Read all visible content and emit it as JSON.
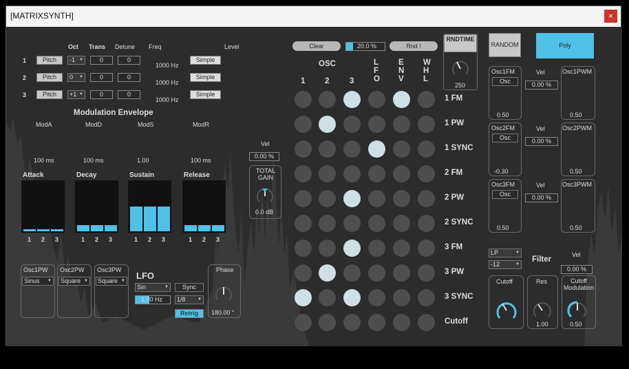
{
  "window": {
    "title": "[MATRIXSYNTH]",
    "close_glyph": "×"
  },
  "osc_section": {
    "headers": {
      "oct": "Oct",
      "trans": "Trans",
      "detune": "Detune",
      "freq": "Freq",
      "level": "Level"
    },
    "rows": [
      {
        "num": "1",
        "mode": "Pitch",
        "oct": "-1",
        "trans": "0",
        "detune": "0",
        "freq": "1000 Hz",
        "wave": "Simple"
      },
      {
        "num": "2",
        "mode": "Pitch",
        "oct": "0",
        "trans": "0",
        "detune": "0",
        "freq": "1000 Hz",
        "wave": "Simple"
      },
      {
        "num": "3",
        "mode": "Pitch",
        "oct": "+1",
        "trans": "0",
        "detune": "0",
        "freq": "1000 Hz",
        "wave": "Simple"
      }
    ]
  },
  "mod_env": {
    "title": "Modulation Envelope",
    "knobs": [
      {
        "label": "ModA",
        "value": "100 ms"
      },
      {
        "label": "ModD",
        "value": "100 ms"
      },
      {
        "label": "ModS",
        "value": "1.00"
      },
      {
        "label": "ModR",
        "value": "100 ms"
      }
    ],
    "vel_label": "Vel",
    "vel_value": "0.00 %",
    "total_gain_label": "TOTAL GAIN",
    "total_gain_value": "0.0 dB"
  },
  "adsr": {
    "groups": [
      {
        "label": "Attack",
        "levels": [
          0.04,
          0.04,
          0.04
        ]
      },
      {
        "label": "Decay",
        "levels": [
          0.12,
          0.12,
          0.12
        ]
      },
      {
        "label": "Sustain",
        "levels": [
          0.5,
          0.5,
          0.5
        ]
      },
      {
        "label": "Release",
        "levels": [
          0.12,
          0.12,
          0.12
        ]
      }
    ],
    "channel_labels": [
      "1",
      "2",
      "3"
    ]
  },
  "pwm": [
    {
      "label": "Osc1PW",
      "wave": "Sinus"
    },
    {
      "label": "Osc2PW",
      "wave": "Square"
    },
    {
      "label": "Osc3PW",
      "wave": "Square"
    }
  ],
  "lfo": {
    "title": "LFO",
    "wave": "Sin",
    "rate": "1.00 Hz",
    "sync_label": "Sync",
    "sync_value": "1/8",
    "retrig": "Retrig",
    "phase_label": "Phase",
    "phase_value": "180.00 °"
  },
  "matrix": {
    "clear": "Clear",
    "percent": "20.0 %",
    "rnd": "Rnd !",
    "osc_header": "OSC",
    "cols": [
      "1",
      "2",
      "3",
      "L F O",
      "E N V",
      "W H L"
    ],
    "rows": [
      "1 FM",
      "1 PW",
      "1 SYNC",
      "2 FM",
      "2 PW",
      "2 SYNC",
      "3 FM",
      "3 PW",
      "3 SYNC",
      "Cutoff"
    ],
    "active": [
      [
        1,
        1
      ],
      [
        2,
        0
      ],
      [
        4,
        0
      ],
      [
        3,
        2
      ],
      [
        2,
        4
      ],
      [
        2,
        6
      ],
      [
        1,
        7
      ],
      [
        0,
        8
      ],
      [
        2,
        8
      ]
    ]
  },
  "rndtime": {
    "label": "RNDTIME",
    "value": "250"
  },
  "right": {
    "random": "RANDOM",
    "poly": "Poly",
    "fm_rows": [
      {
        "fm_label": "Osc1FM",
        "src": "Osc",
        "value": "0.50",
        "vel_label": "Vel",
        "vel_value": "0.00 %",
        "pwm_label": "Osc1PWM",
        "pwm_value": "0.50"
      },
      {
        "fm_label": "Osc2FM",
        "src": "Osc",
        "value": "-0.30",
        "vel_label": "Vel",
        "vel_value": "0.00 %",
        "pwm_label": "Osc2PWM",
        "pwm_value": "0.50"
      },
      {
        "fm_label": "Osc3FM",
        "src": "Osc",
        "value": "0.50",
        "vel_label": "Vel",
        "vel_value": "0.00 %",
        "pwm_label": "Osc3PWM",
        "pwm_value": "0.50"
      }
    ],
    "filter": {
      "type": "LP",
      "slope": "-12",
      "title": "Filter",
      "vel_label": "Vel",
      "vel_value": "0.00 %",
      "cutoff_label": "Cutoff",
      "res_label": "Res",
      "res_value": "1.00",
      "mod_label": "Cutoff Modulation",
      "mod_value": "0.50"
    }
  },
  "colors": {
    "accent": "#4fc1e8",
    "panel": "#2c2c2c",
    "dot": "#4e4e4e",
    "dot_on": "#cfdfe6"
  }
}
